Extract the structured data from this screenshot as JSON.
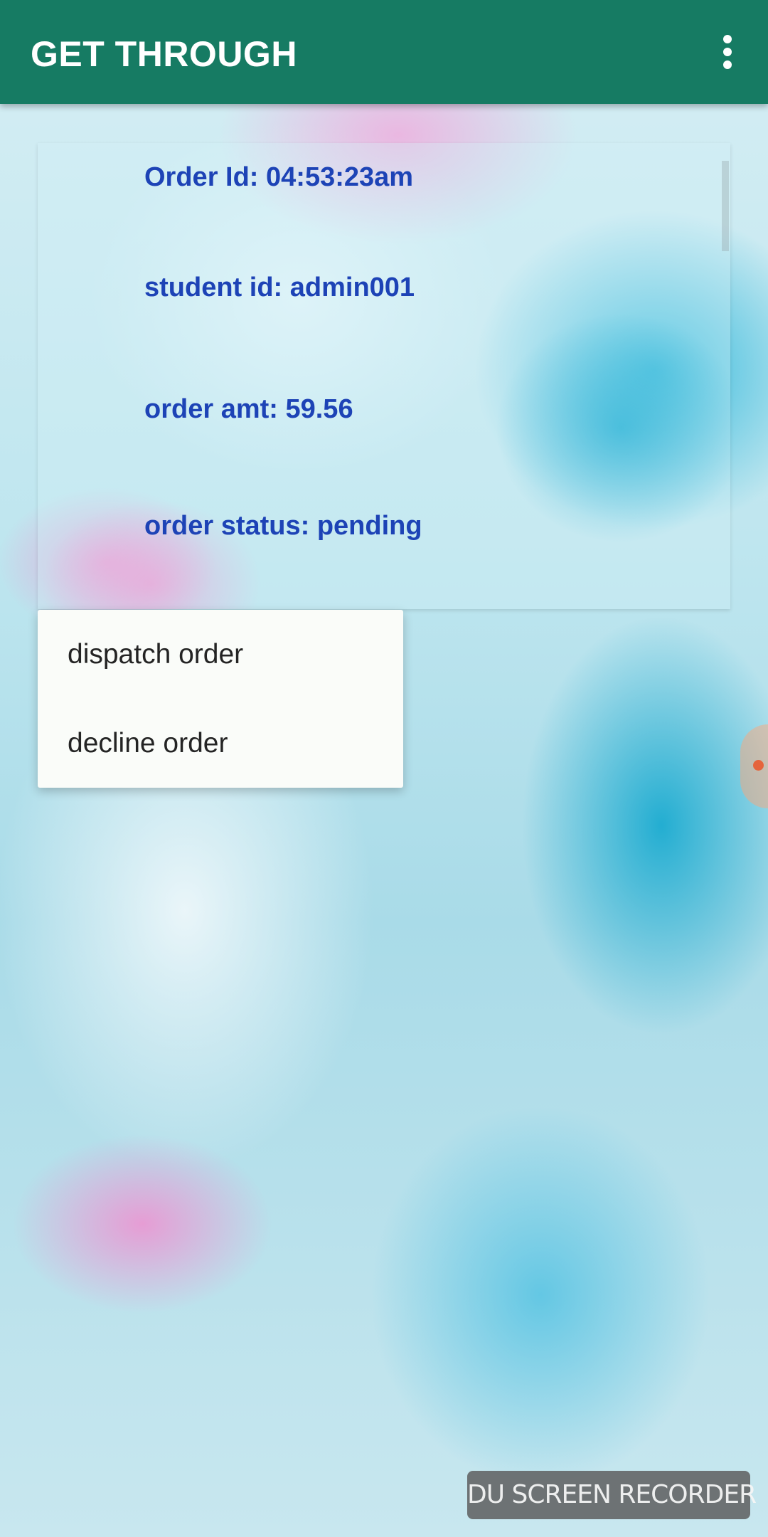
{
  "app_bar": {
    "title": "GET THROUGH",
    "overflow_icon": "vertical-ellipsis-icon",
    "background_color": "#167b63"
  },
  "order": {
    "order_id": "Order Id: 04:53:23am",
    "student_id": "student id: admin001",
    "order_amount": "order amt: 59.56",
    "order_status": "order status: pending",
    "text_color": "#1d43b6"
  },
  "context_menu": {
    "items": [
      {
        "label": "dispatch order"
      },
      {
        "label": "decline order"
      }
    ],
    "background_color": "#fafcf9"
  },
  "watermark": {
    "text": "DU SCREEN RECORDER"
  }
}
